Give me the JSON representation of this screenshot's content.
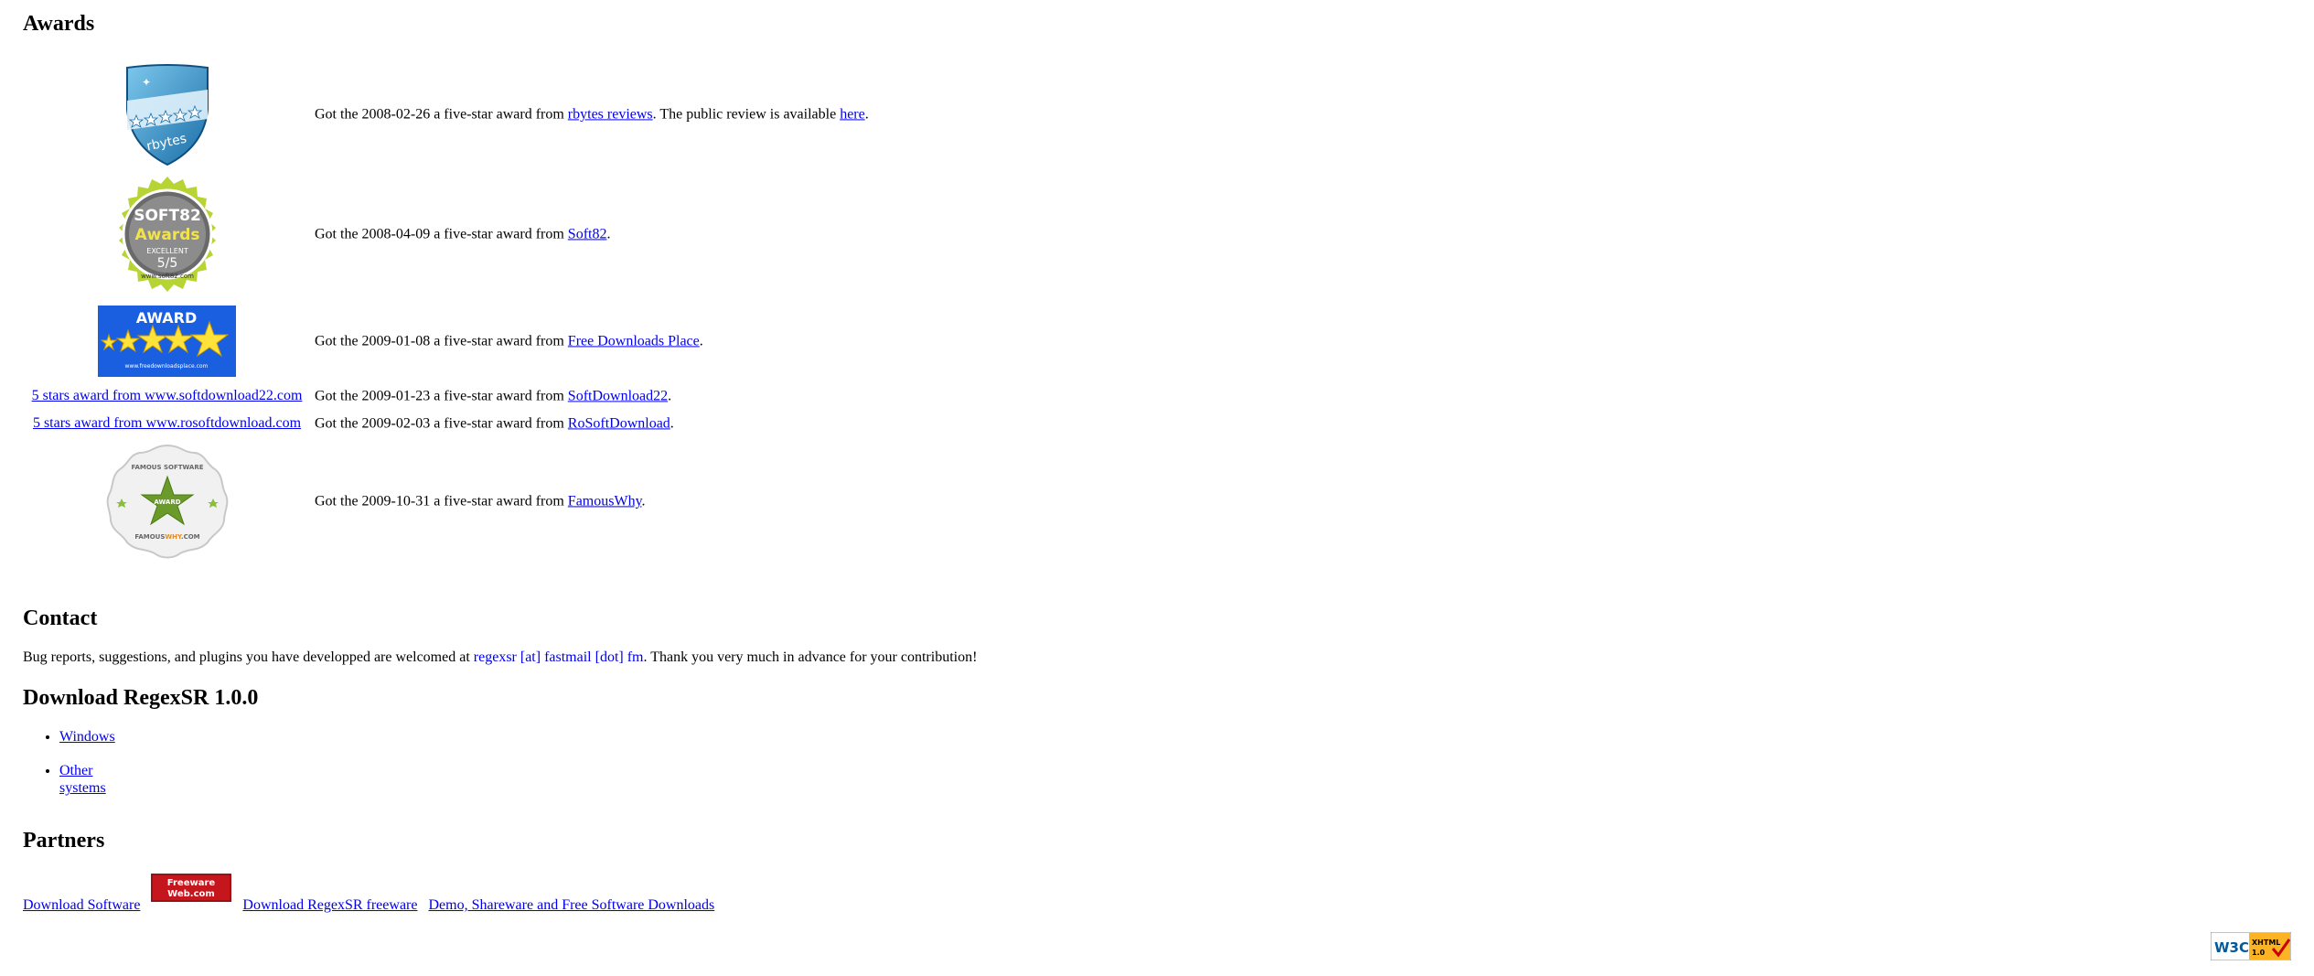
{
  "awards": {
    "heading": "Awards",
    "items": [
      {
        "pre": "Got the 2008-02-26 a five-star award from ",
        "link": "rbytes reviews",
        "mid": ". The public review is available ",
        "link2": "here",
        "post": ".",
        "badge_text": "rbytes"
      },
      {
        "pre": "Got the 2008-04-09 a five-star award from ",
        "link": "Soft82",
        "post": ".",
        "badge_title": "SOFT82",
        "badge_sub": "Awards",
        "badge_small": "EXCELLENT",
        "badge_score": "5/5",
        "badge_url": "www.soft82.com"
      },
      {
        "pre": "Got the 2009-01-08 a five-star award from ",
        "link": "Free Downloads Place",
        "post": ".",
        "badge_title": "AWARD",
        "badge_url": "www.freedownloadsplace.com"
      },
      {
        "badge_link": "5 stars award from www.softdownload22.com",
        "pre": "Got the 2009-01-23 a five-star award from ",
        "link": "SoftDownload22",
        "post": "."
      },
      {
        "badge_link": "5 stars award from www.rosoftdownload.com",
        "pre": "Got the 2009-02-03 a five-star award from ",
        "link": "RoSoftDownload",
        "post": "."
      },
      {
        "pre": "Got the 2009-10-31 a five-star award from ",
        "link": "FamousWhy",
        "post": ".",
        "badge_top": "FAMOUS SOFTWARE",
        "badge_center": "AWARD",
        "badge_url_a": "FAMOUS",
        "badge_url_b": "WHY",
        "badge_url_c": ".COM"
      }
    ]
  },
  "contact": {
    "heading": "Contact",
    "pre": "Bug reports, suggestions, and plugins you have developped are welcomed at ",
    "email": "regexsr [at] fastmail [dot] fm",
    "post": ". Thank you very much in advance for your contribution!"
  },
  "download": {
    "heading": "Download RegexSR 1.0.0",
    "links": [
      "Windows",
      "Other systems"
    ]
  },
  "partners": {
    "heading": "Partners",
    "link1": "Download Software",
    "badge_line1": "Freeware",
    "badge_line2": "Web.com",
    "link2": "Download RegexSR freeware",
    "link3": "Demo, Shareware and Free Software Downloads"
  },
  "w3c": {
    "w3c": "W3C",
    "xhtml": "XHTML",
    "version": "1.0"
  }
}
